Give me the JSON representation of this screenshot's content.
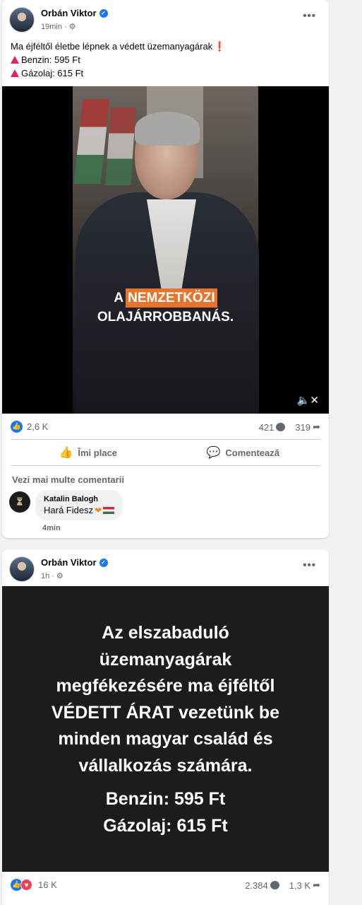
{
  "posts": [
    {
      "author": "Orbán Viktor",
      "time": "19min",
      "caption_line1": "Ma éjféltől életbe lépnek a védett üzemanyagárak",
      "caption_line2": "Benzin: 595 Ft",
      "caption_line3": "Gázolaj: 615 Ft",
      "video_overlay_prefix": "A",
      "video_overlay_highlight": "NEMZETKÖZI",
      "video_overlay_line2": "OLAJÁRROBBANÁS.",
      "reactions": "2,6 K",
      "comments": "421",
      "shares": "319",
      "like_label": "Îmi place",
      "comment_label": "Comentează",
      "more_comments": "Vezi mai multe comentarii",
      "comment_author": "Katalin Balogh",
      "comment_text": "Hará Fidesz",
      "comment_time": "4min"
    },
    {
      "author": "Orbán Viktor",
      "time": "1h",
      "image_text_lines": [
        "Az elszabaduló",
        "üzemanyagárak",
        "megfékezésére ma éjféltől",
        "VÉDETT ÁRAT vezetünk be",
        "minden magyar család és",
        "vállalkozás számára."
      ],
      "image_prices": [
        "Benzin: 595 Ft",
        "Gázolaj: 615 Ft"
      ],
      "reactions": "16 K",
      "comments": "2.384",
      "shares": "1,3 K"
    }
  ],
  "colors": {
    "accent": "#1877f2",
    "highlight": "#e8742c",
    "alert": "#e0245e"
  }
}
